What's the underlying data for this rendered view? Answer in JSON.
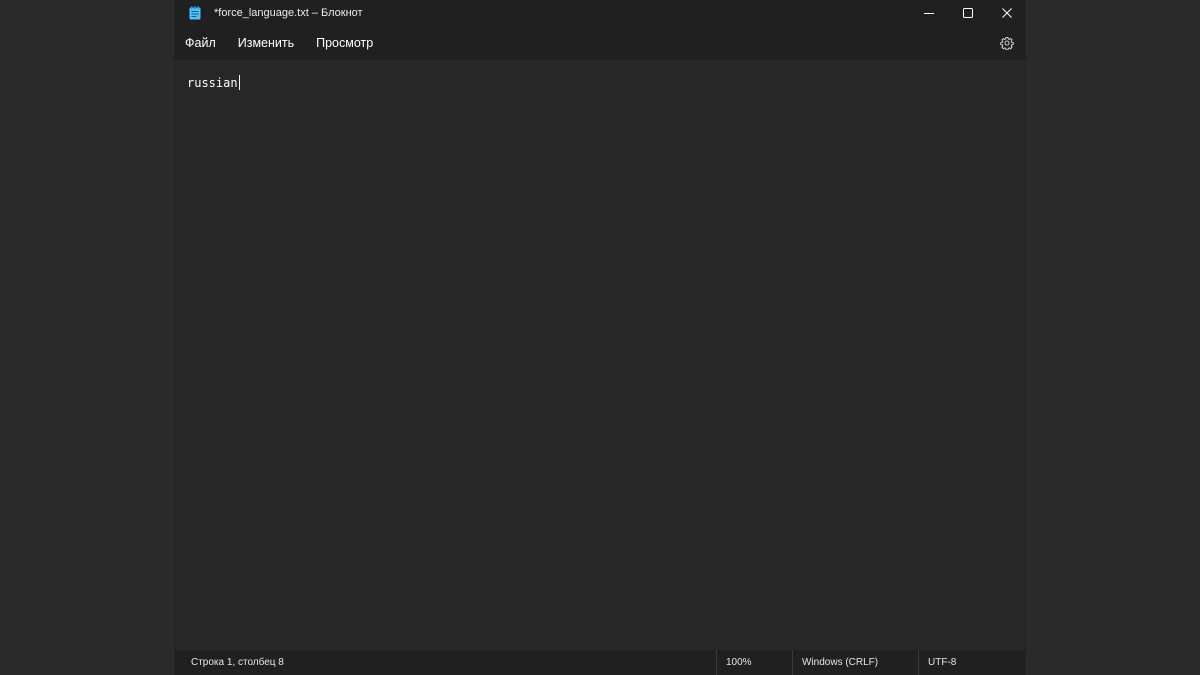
{
  "window": {
    "title": "*force_language.txt – Блокнот"
  },
  "icons": {
    "app": "notepad-icon",
    "minimize": "minimize-icon",
    "maximize": "maximize-icon",
    "close": "close-icon",
    "settings": "gear-icon"
  },
  "menu": {
    "file": "Файл",
    "edit": "Изменить",
    "view": "Просмотр"
  },
  "editor": {
    "content": "russian"
  },
  "status": {
    "position": "Строка 1, столбец 8",
    "zoom": "100%",
    "line_ending": "Windows (CRLF)",
    "encoding": "UTF-8"
  },
  "colors": {
    "background": "#272727",
    "chrome": "#202020",
    "text": "#ffffff",
    "icon_accent": "#4fc3f7"
  }
}
